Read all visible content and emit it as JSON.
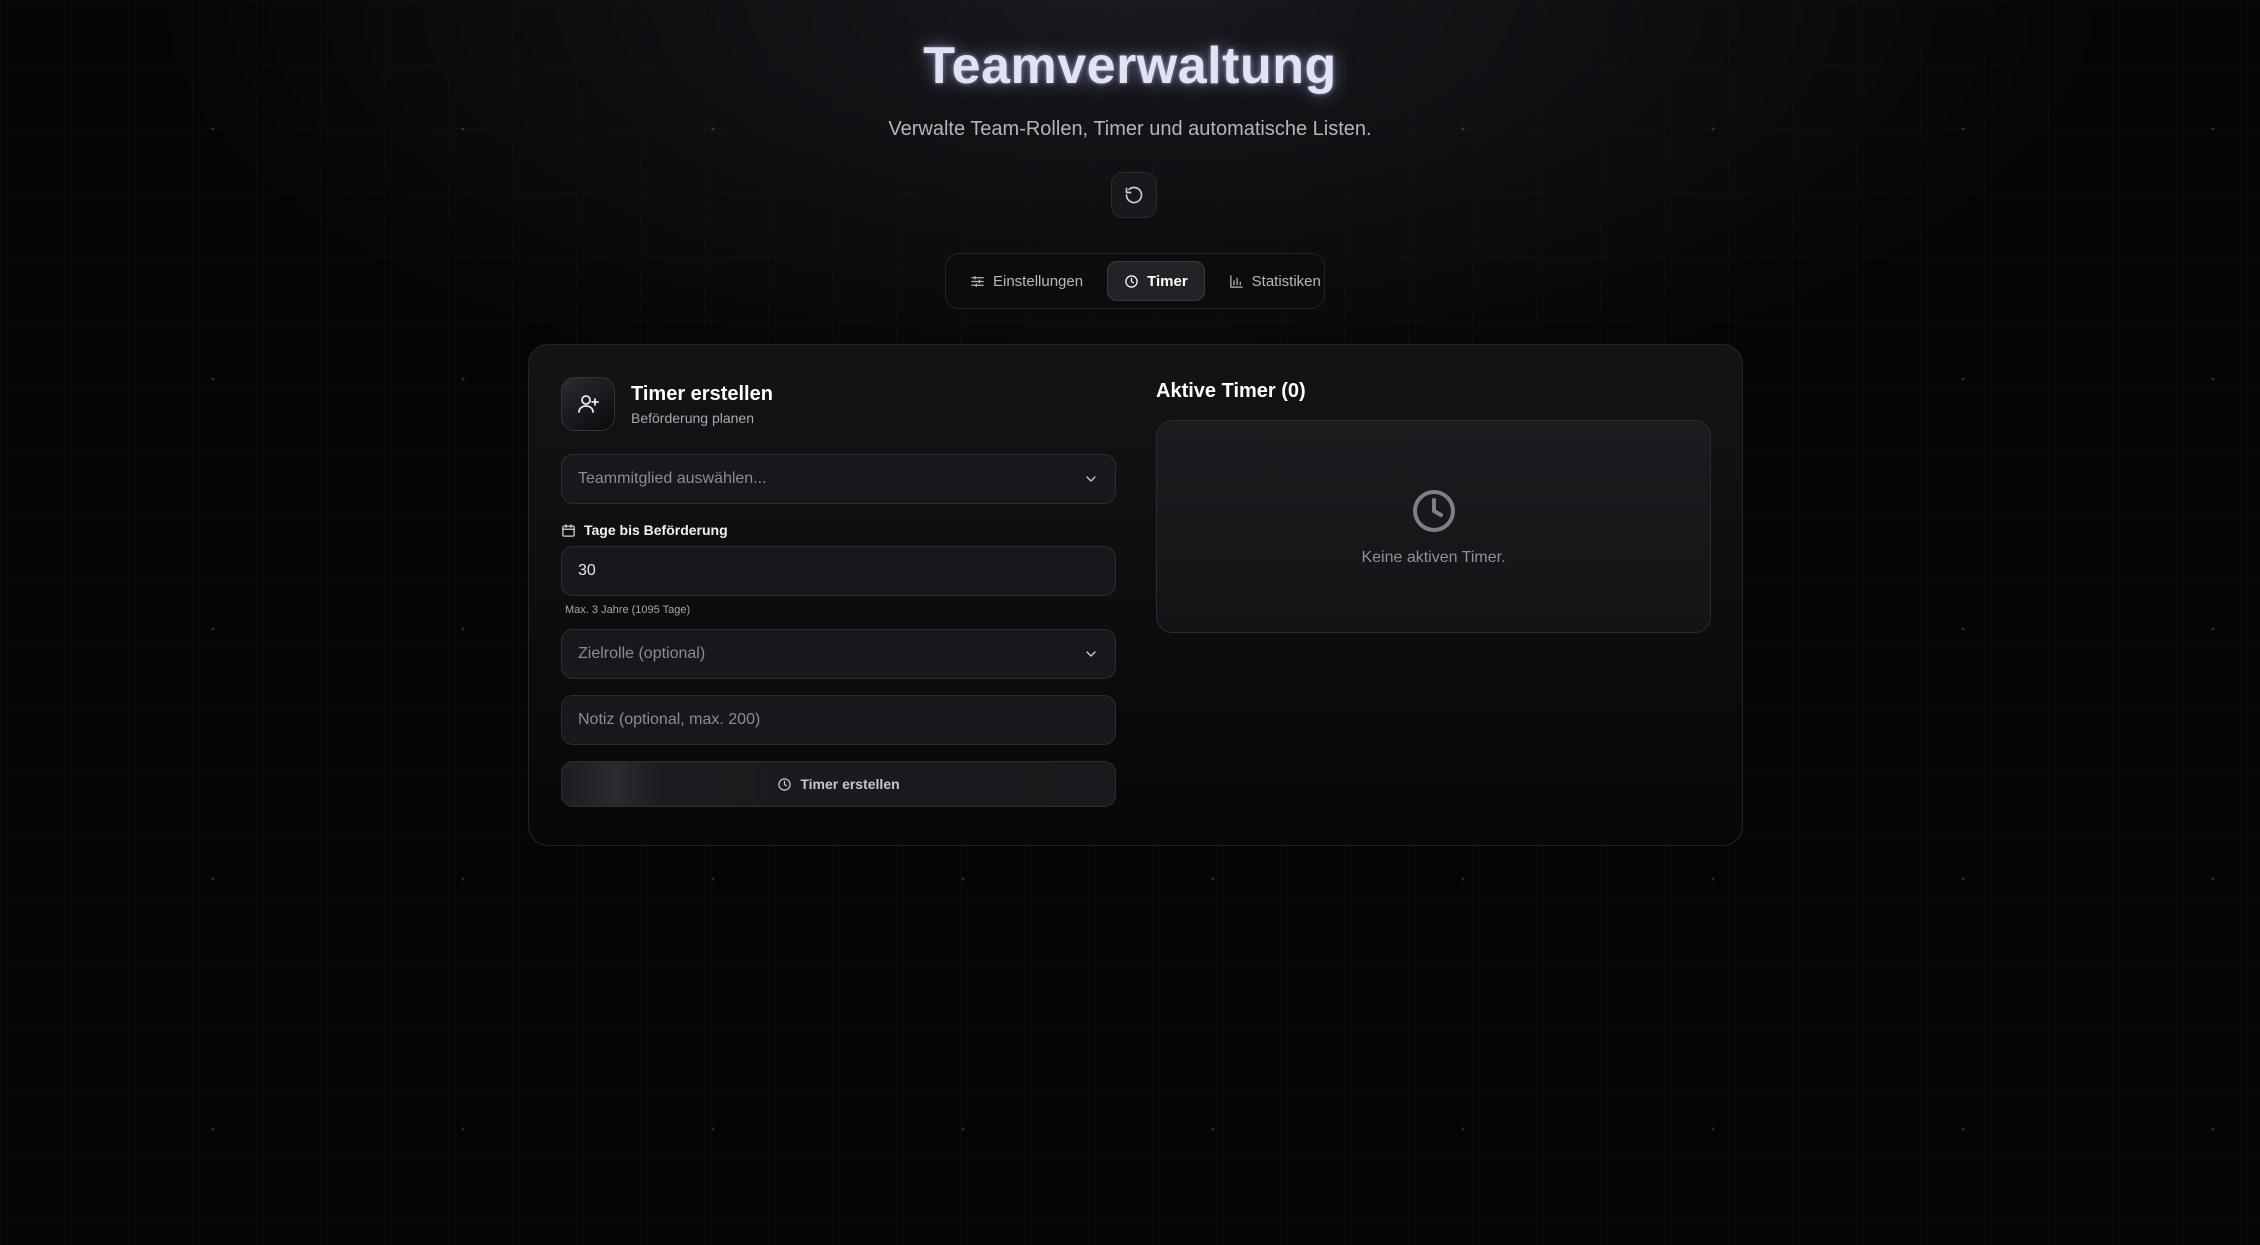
{
  "header": {
    "title": "Teamverwaltung",
    "subtitle": "Verwalte Team-Rollen, Timer und automatische Listen."
  },
  "toolbar": {
    "refresh_icon": "refresh-icon"
  },
  "tabs": [
    {
      "label": "Einstellungen",
      "icon": "sliders-icon",
      "active": false
    },
    {
      "label": "Timer",
      "icon": "clock-icon",
      "active": true
    },
    {
      "label": "Statistiken",
      "icon": "bar-chart-icon",
      "active": false
    }
  ],
  "create_timer": {
    "title": "Timer erstellen",
    "subtitle": "Beförderung planen",
    "icon": "user-plus-icon",
    "member_select": {
      "placeholder": "Teammitglied auswählen..."
    },
    "days_label": "Tage bis Beförderung",
    "days_value": "30",
    "days_hint": "Max. 3 Jahre (1095 Tage)",
    "role_select": {
      "placeholder": "Zielrolle (optional)"
    },
    "note": {
      "placeholder": "Notiz (optional, max. 200)"
    },
    "submit_label": "Timer erstellen"
  },
  "active_timers": {
    "title": "Aktive Timer (0)",
    "empty_text": "Keine aktiven Timer.",
    "empty_icon": "clock-icon"
  },
  "colors": {
    "background": "#050506",
    "card": "#141417",
    "text": "#e6e7ea",
    "muted": "#8e9199",
    "title_glow": "#aab4eb"
  }
}
